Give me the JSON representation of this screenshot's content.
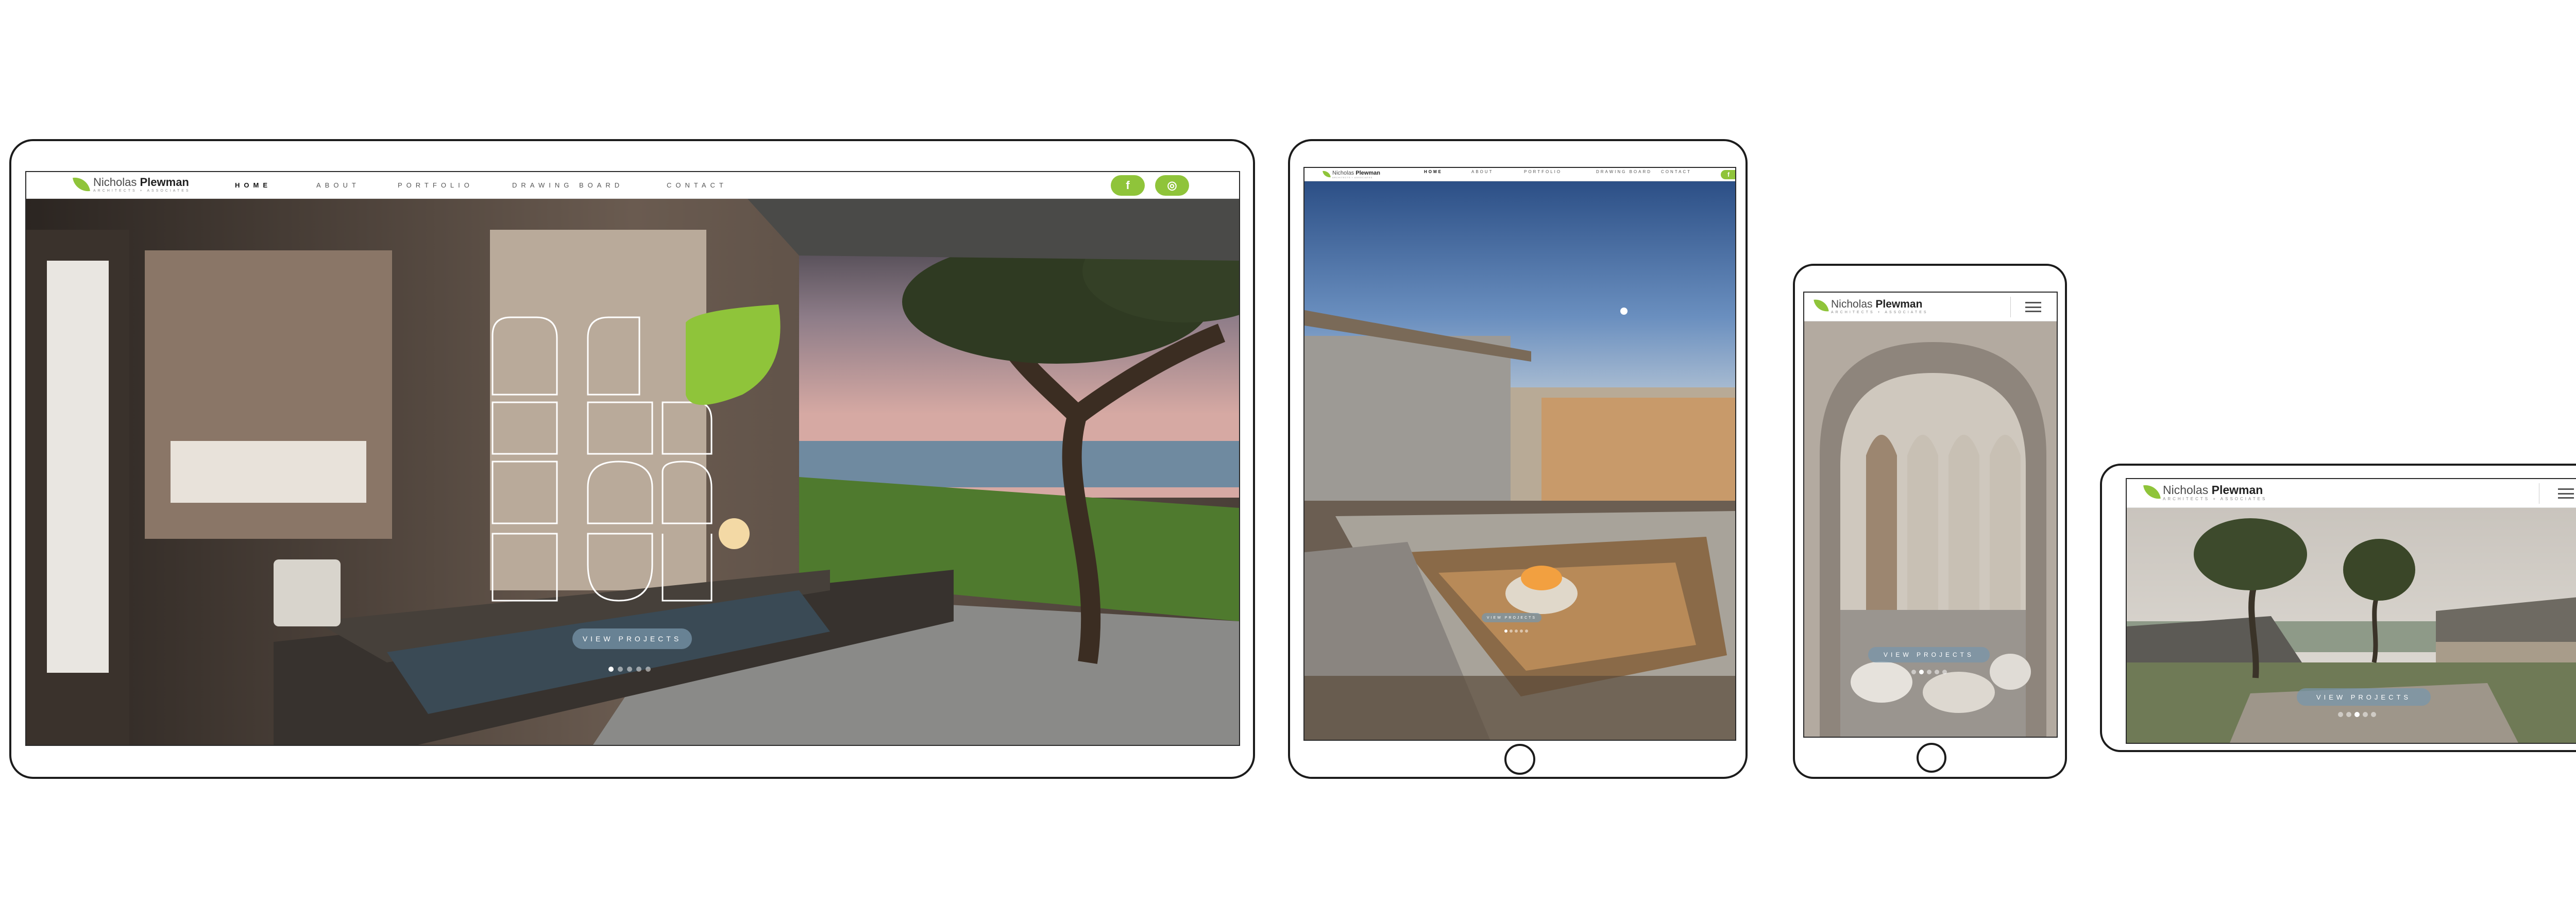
{
  "site": {
    "brand_first": "Nicholas",
    "brand_last": "Plewman",
    "tagline": "ARCHITECTS + ASSOCIATES",
    "nav": [
      "HOME",
      "ABOUT",
      "PORTFOLIO",
      "DRAWING BOARD",
      "CONTACT"
    ],
    "cta": "VIEW PROJECTS",
    "social": {
      "facebook_glyph": "f",
      "instagram_glyph": "◎"
    },
    "accent": "#8fc43a"
  },
  "devices": {
    "desktop": {
      "active_nav": "HOME",
      "slide_count": 5,
      "active_slide": 1
    },
    "tablet": {
      "active_nav": "HOME",
      "slide_count": 5,
      "active_slide": 1
    },
    "phone_portrait": {
      "slide_count": 5,
      "active_slide": 2
    },
    "phone_landscape": {
      "slide_count": 5,
      "active_slide": 3
    }
  }
}
